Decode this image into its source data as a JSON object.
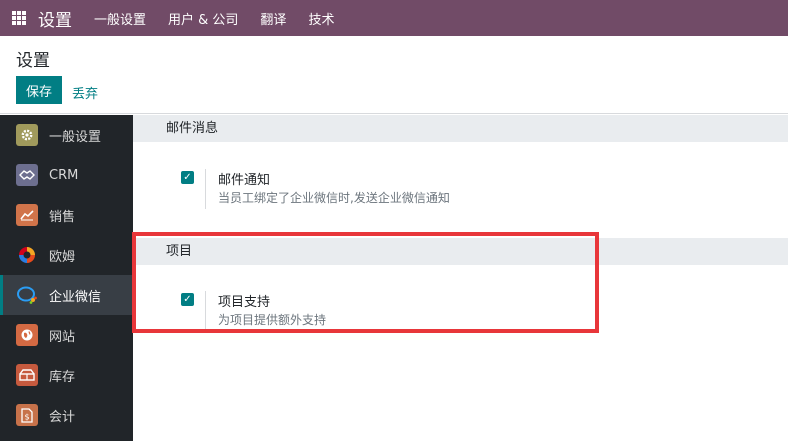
{
  "navbar": {
    "app_icon": "apps-grid-icon",
    "brand": "设置",
    "menu": [
      "一般设置",
      "用户 & 公司",
      "翻译",
      "技术"
    ]
  },
  "control": {
    "title": "设置",
    "save_label": "保存",
    "discard_label": "丢弃"
  },
  "sidebar": {
    "items": [
      {
        "label": "一般设置",
        "icon": "gear-icon",
        "color": "#a09a5c"
      },
      {
        "label": "CRM",
        "icon": "handshake-icon",
        "color": "#6d6f8f"
      },
      {
        "label": "销售",
        "icon": "chart-up-icon",
        "color": "#d1744a"
      },
      {
        "label": "欧姆",
        "icon": "ohm-logo-icon",
        "color": "#e84b1c"
      },
      {
        "label": "企业微信",
        "icon": "wecom-icon",
        "color": "#2a9df4",
        "active": true
      },
      {
        "label": "网站",
        "icon": "globe-icon",
        "color": "#d46a43"
      },
      {
        "label": "库存",
        "icon": "boxes-icon",
        "color": "#c65a3e"
      },
      {
        "label": "会计",
        "icon": "invoice-icon",
        "color": "#c7724a"
      }
    ]
  },
  "sections": [
    {
      "title": "邮件消息",
      "setting": {
        "title": "邮件通知",
        "desc": "当员工绑定了企业微信时,发送企业微信通知",
        "checked": true
      }
    },
    {
      "title": "项目",
      "setting": {
        "title": "项目支持",
        "desc": "为项目提供额外支持",
        "checked": true
      }
    }
  ],
  "colors": {
    "navbar": "#714b67",
    "primary": "#017e84",
    "sidebar": "#212529",
    "highlight": "#e8363a"
  }
}
